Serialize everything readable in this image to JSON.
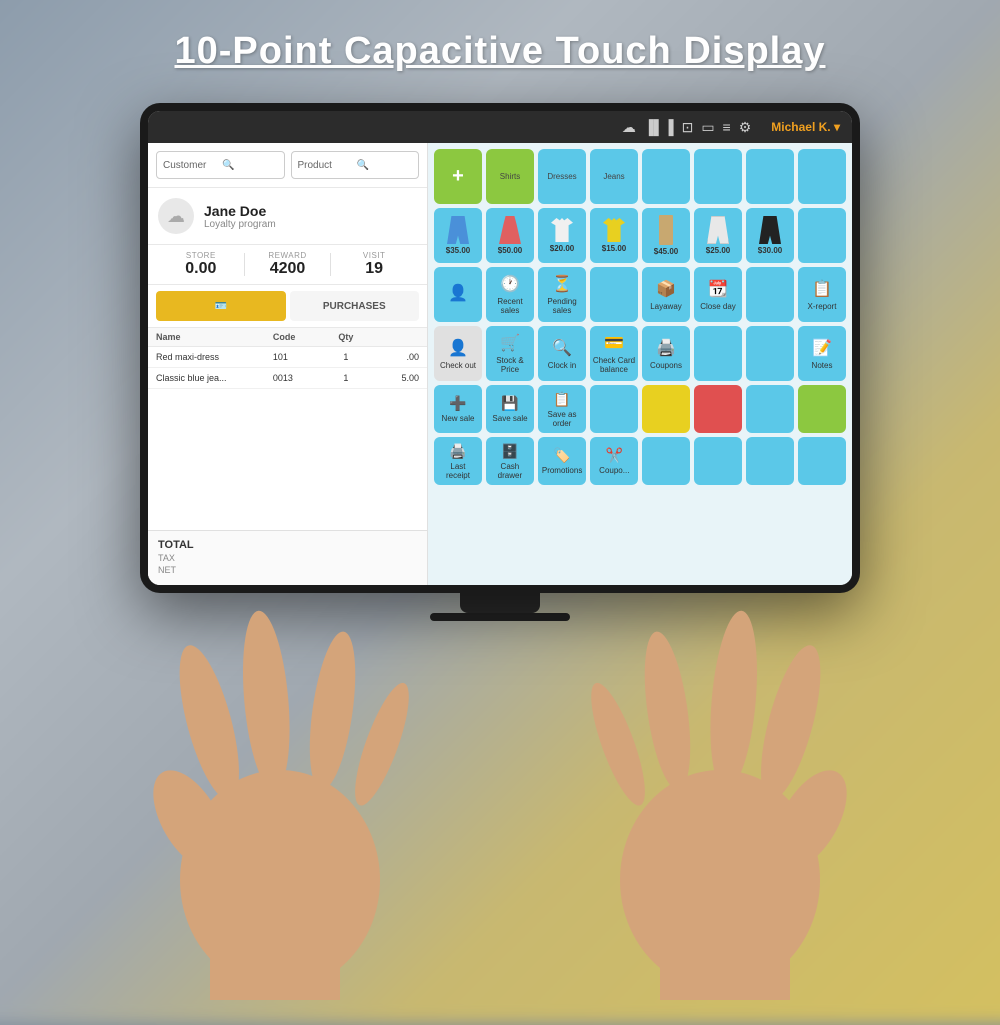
{
  "page": {
    "title": "10-Point Capacitive Touch Display"
  },
  "topbar": {
    "user": "Michael K. ▾",
    "icons": [
      "☁",
      "▐▐",
      "☐",
      "▭",
      "≡",
      "⚙"
    ]
  },
  "search": {
    "customer_placeholder": "Customer",
    "product_placeholder": "Product"
  },
  "customer": {
    "name": "Jane Doe",
    "loyalty": "Loyalty program",
    "store_label": "STORE",
    "store_value": "0.00",
    "reward_label": "REWARD",
    "reward_value": "4200",
    "visit_label": "VISIT",
    "visit_value": "19"
  },
  "tabs": {
    "tab1_label": "🪪",
    "tab2_label": "PURCHASES"
  },
  "order": {
    "headers": [
      "Name",
      "Code",
      "Qty",
      ""
    ],
    "rows": [
      {
        "name": "Red maxi-dress",
        "code": "101",
        "qty": "1",
        "price": ".00"
      },
      {
        "name": "Classic blue jea...",
        "code": "0013",
        "qty": "1",
        "price": "5.00"
      }
    ]
  },
  "totals": {
    "total_label": "TOTAL",
    "tax_label": "TAX",
    "net_label": "NET"
  },
  "products": {
    "row1": [
      {
        "label": "Shirts",
        "color": "#5bc8e8"
      },
      {
        "label": "Dresses",
        "color": "#5bc8e8"
      },
      {
        "label": "Jeans",
        "color": "#5bc8e8"
      },
      {
        "label": "",
        "color": "#5bc8e8"
      },
      {
        "label": "",
        "color": "#5bc8e8"
      },
      {
        "label": "",
        "color": "#5bc8e8"
      },
      {
        "label": "",
        "color": "#5bc8e8"
      }
    ],
    "row2_prices": [
      "$35.00",
      "$50.00",
      "$20.00",
      "$15.00",
      "$45.00",
      "$25.00",
      "$30.00"
    ],
    "actions": [
      {
        "icon": "👤+",
        "label": ""
      },
      {
        "icon": "🕐",
        "label": "Recent sales"
      },
      {
        "icon": "⏳",
        "label": "Pending sales"
      },
      {
        "icon": "📦",
        "label": ""
      },
      {
        "icon": "📅",
        "label": "Layaway"
      },
      {
        "icon": "📆",
        "label": "Close day"
      },
      {
        "icon": "📋",
        "label": ""
      },
      {
        "icon": "📊",
        "label": "X-report"
      }
    ],
    "row3": [
      {
        "icon": "🔍",
        "label": ""
      },
      {
        "icon": "👤",
        "label": "Check out"
      },
      {
        "icon": "🛒",
        "label": "Stock & Price"
      },
      {
        "icon": "🔍",
        "label": "Clock in"
      },
      {
        "icon": "💳",
        "label": "Check Card balance"
      },
      {
        "icon": "🖨️",
        "label": "Coupons"
      },
      {
        "icon": "📋",
        "label": ""
      },
      {
        "icon": "📝",
        "label": "Notes"
      }
    ],
    "row4": [
      {
        "icon": "➕",
        "label": "New sale"
      },
      {
        "icon": "💾",
        "label": "Save sale"
      },
      {
        "icon": "📋",
        "label": "Save as order"
      },
      {
        "icon": "🔖",
        "label": ""
      },
      {
        "icon": "",
        "label": ""
      },
      {
        "icon": "",
        "label": ""
      },
      {
        "icon": "",
        "label": ""
      },
      {
        "icon": "📝",
        "label": ""
      }
    ],
    "row5": [
      {
        "icon": "🖨️",
        "label": "Last receipt"
      },
      {
        "icon": "🗄️",
        "label": "Cash drawer"
      },
      {
        "icon": "🏷️",
        "label": "Promotions"
      },
      {
        "icon": "✂️",
        "label": "Coupo..."
      },
      {
        "icon": "",
        "label": ""
      },
      {
        "icon": "",
        "label": ""
      },
      {
        "icon": "",
        "label": ""
      },
      {
        "icon": "",
        "label": ""
      }
    ]
  }
}
